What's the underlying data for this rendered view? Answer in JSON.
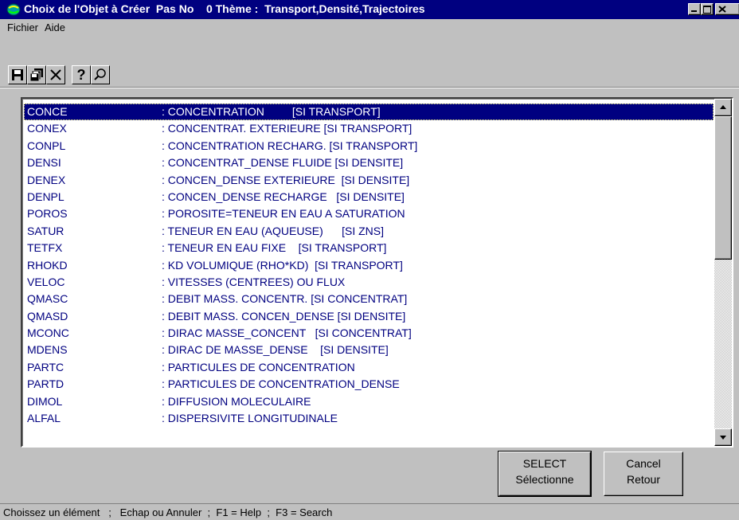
{
  "window": {
    "title": "Choix de l'Objet à Créer  Pas No    0 Thème :  Transport,Densité,Trajectoires"
  },
  "menu": {
    "items": [
      "Fichier",
      "Aide"
    ]
  },
  "toolbar": {
    "help_label": "?"
  },
  "list": {
    "rows": [
      {
        "code": "CONCE",
        "desc": ": CONCENTRATION         [SI TRANSPORT]"
      },
      {
        "code": "CONEX",
        "desc": ": CONCENTRAT. EXTERIEURE [SI TRANSPORT]"
      },
      {
        "code": "CONPL",
        "desc": ": CONCENTRATION RECHARG. [SI TRANSPORT]"
      },
      {
        "code": "DENSI",
        "desc": ": CONCENTRAT_DENSE FLUIDE [SI DENSITE]"
      },
      {
        "code": "DENEX",
        "desc": ": CONCEN_DENSE EXTERIEURE  [SI DENSITE]"
      },
      {
        "code": "DENPL",
        "desc": ": CONCEN_DENSE RECHARGE   [SI DENSITE]"
      },
      {
        "code": "POROS",
        "desc": ": POROSITE=TENEUR EN EAU A SATURATION"
      },
      {
        "code": "SATUR",
        "desc": ": TENEUR EN EAU (AQUEUSE)      [SI ZNS]"
      },
      {
        "code": "TETFX",
        "desc": ": TENEUR EN EAU FIXE    [SI TRANSPORT]"
      },
      {
        "code": "RHOKD",
        "desc": ": KD VOLUMIQUE (RHO*KD)  [SI TRANSPORT]"
      },
      {
        "code": "VELOC",
        "desc": ": VITESSES (CENTREES) OU FLUX"
      },
      {
        "code": "QMASC",
        "desc": ": DEBIT MASS. CONCENTR. [SI CONCENTRAT]"
      },
      {
        "code": "QMASD",
        "desc": ": DEBIT MASS. CONCEN_DENSE [SI DENSITE]"
      },
      {
        "code": "MCONC",
        "desc": ": DIRAC MASSE_CONCENT   [SI CONCENTRAT]"
      },
      {
        "code": "MDENS",
        "desc": ": DIRAC DE MASSE_DENSE    [SI DENSITE]"
      },
      {
        "code": "PARTC",
        "desc": ": PARTICULES DE CONCENTRATION"
      },
      {
        "code": "PARTD",
        "desc": ": PARTICULES DE CONCENTRATION_DENSE"
      },
      {
        "code": "DIMOL",
        "desc": ": DIFFUSION MOLECULAIRE"
      },
      {
        "code": "ALFAL",
        "desc": ": DISPERSIVITE LONGITUDINALE"
      }
    ],
    "selected_index": 0
  },
  "buttons": {
    "select_line1": "SELECT",
    "select_line2": "Sélectionne",
    "cancel_line1": "Cancel",
    "cancel_line2": "Retour"
  },
  "status": {
    "text": "Choissez un élément   ;   Echap ou Annuler  ;  F1 = Help  ;  F3 = Search"
  },
  "colors": {
    "titlebar": "#000080",
    "list_text": "#000080",
    "selection": "#000080",
    "face": "#c0c0c0"
  }
}
